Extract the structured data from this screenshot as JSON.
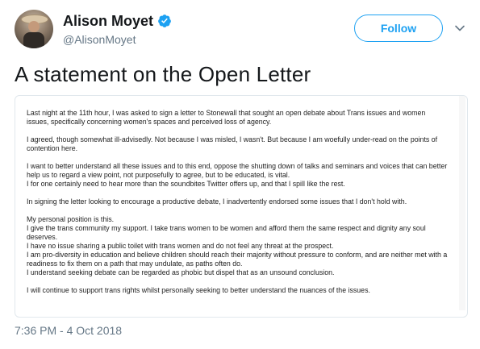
{
  "profile": {
    "display_name": "Alison Moyet",
    "handle": "@AlisonMoyet",
    "verified_icon": "verified-badge-icon",
    "accent": "#1da1f2"
  },
  "actions": {
    "follow_label": "Follow",
    "menu_icon": "chevron-down-icon"
  },
  "tweet": {
    "text": "A statement on the Open Letter",
    "timestamp": "7:36 PM - 4 Oct 2018"
  },
  "letter": {
    "paragraphs": [
      [
        "Last night at the 11th hour, I was asked to sign a letter to Stonewall that sought an open debate about Trans issues and women",
        "issues, specifically concerning women's spaces and perceived loss of agency."
      ],
      [
        "I agreed, though somewhat ill-advisedly. Not because I was misled, I wasn't. But because I am woefully under-read on the points of",
        "contention here."
      ],
      [
        "I want to better understand all these issues and to this end, oppose the shutting down of talks and seminars and voices that can better",
        "help us to regard a view point, not purposefully to agree, but to be educated, is vital.",
        "I for one certainly need to hear more than the soundbites Twitter offers up, and that I spill like the rest."
      ],
      [
        "In signing the letter looking to encourage a productive debate, I inadvertently endorsed some issues that I don't hold with."
      ],
      [
        "My personal position is this.",
        "I give the trans community my support. I take trans women to be women and afford them the same respect and dignity any soul",
        "deserves.",
        "I have no issue sharing a public toilet with trans women and do not feel any threat at the prospect.",
        "I am pro-diversity in education and believe children should reach their majority without pressure to conform, and are neither met with a",
        "readiness to fix them on a path that may undulate, as paths often do.",
        "I understand seeking debate can be regarded as phobic but dispel that as an unsound conclusion."
      ],
      [
        "I will continue to support trans rights whilst personally seeking to better understand the nuances of the issues."
      ]
    ]
  }
}
